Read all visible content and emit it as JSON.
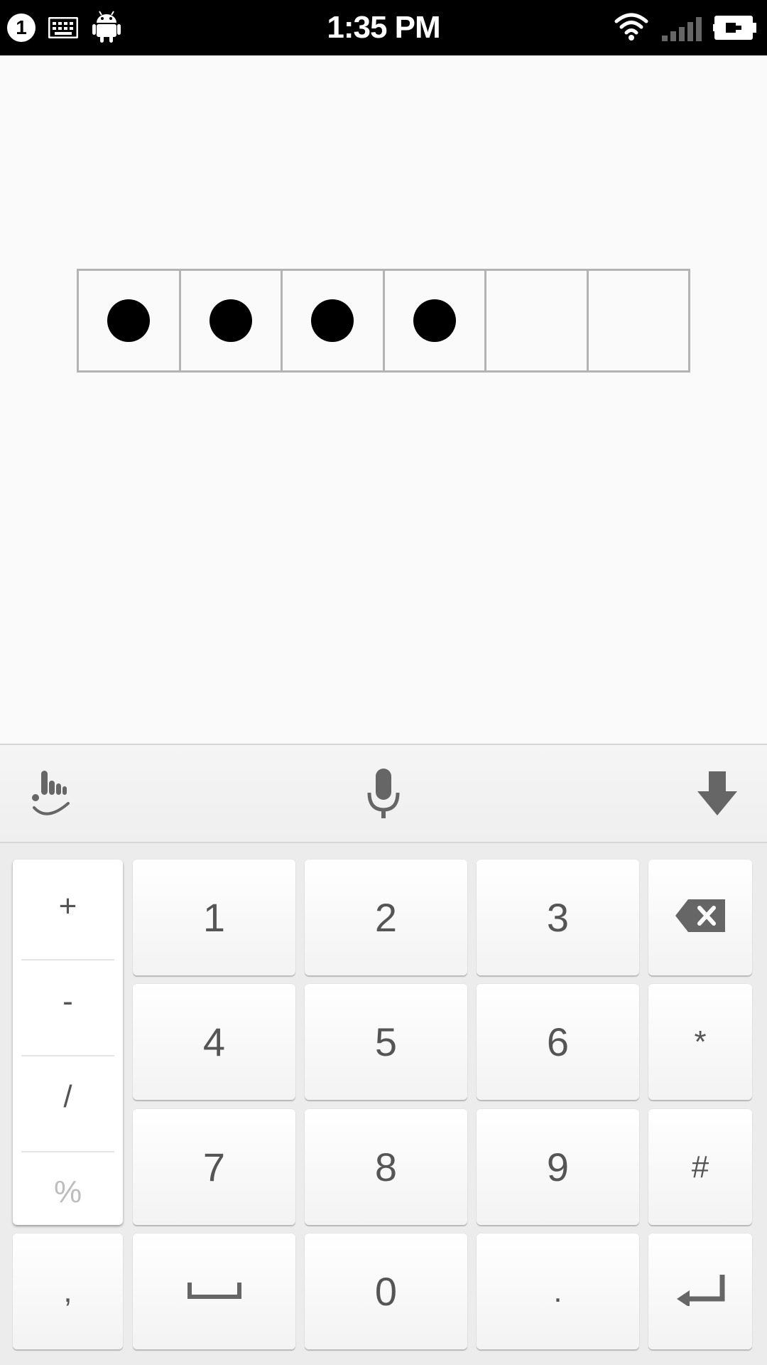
{
  "status_bar": {
    "notification_count": "1",
    "time": "1:35 PM",
    "icons": [
      "keyboard-icon",
      "android-icon",
      "wifi-icon",
      "signal-icon",
      "battery-charging-icon"
    ]
  },
  "pin": {
    "length": 6,
    "filled": 4
  },
  "toolbar": {
    "icons": [
      "handwriting-icon",
      "microphone-icon",
      "hide-keyboard-icon"
    ]
  },
  "popup_symbols": [
    "+",
    "-",
    "/",
    "%"
  ],
  "keys": {
    "row1": [
      "1",
      "2",
      "3"
    ],
    "row2": [
      "4",
      "5",
      "6",
      "*"
    ],
    "row3": [
      "7",
      "8",
      "9",
      "#"
    ],
    "row4": [
      ",",
      "0",
      "."
    ]
  },
  "colors": {
    "status_bar_bg": "#000000",
    "background": "#fafafa",
    "key_text": "#555555",
    "pin_border": "#b3b3b3"
  }
}
